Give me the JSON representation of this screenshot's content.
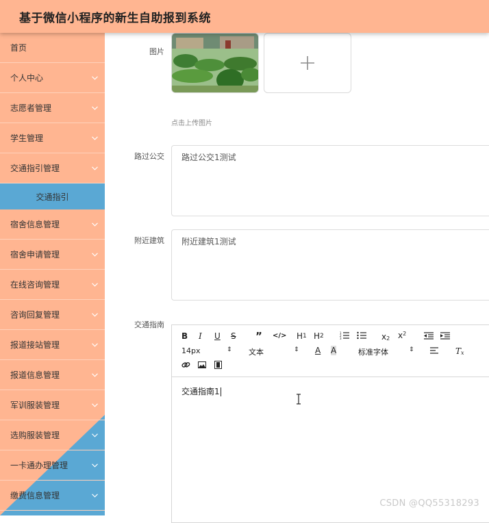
{
  "header": {
    "title": "基于微信小程序的新生自助报到系统"
  },
  "sidebar": {
    "items": [
      {
        "label": "首页",
        "chevron": false
      },
      {
        "label": "个人中心",
        "chevron": true
      },
      {
        "label": "志愿者管理",
        "chevron": true
      },
      {
        "label": "学生管理",
        "chevron": true
      },
      {
        "label": "交通指引管理",
        "chevron": true
      },
      {
        "label": "交通指引",
        "sub": true
      },
      {
        "label": "宿舍信息管理",
        "chevron": true
      },
      {
        "label": "宿舍申请管理",
        "chevron": true
      },
      {
        "label": "在线咨询管理",
        "chevron": true
      },
      {
        "label": "咨询回复管理",
        "chevron": true
      },
      {
        "label": "报道接站管理",
        "chevron": true
      },
      {
        "label": "报道信息管理",
        "chevron": true
      },
      {
        "label": "军训服装管理",
        "chevron": true
      },
      {
        "label": "选购服装管理",
        "chevron": true
      },
      {
        "label": "一卡通办理管理",
        "chevron": true
      },
      {
        "label": "缴费信息管理",
        "chevron": true
      }
    ],
    "colors": {
      "bg": "#ffb591",
      "accent": "#5aa8d4"
    }
  },
  "form": {
    "image_label": "图片",
    "upload_hint": "点击上传图片",
    "bus_label": "路过公交",
    "bus_value": "路过公交1测试",
    "building_label": "附近建筑",
    "building_value": "附近建筑1测试",
    "guide_label": "交通指南"
  },
  "editor": {
    "font_size": "14px",
    "text_style": "文本",
    "font_family": "标准字体",
    "content": "交通指南1",
    "toolbar_icons": [
      "bold-icon",
      "italic-icon",
      "underline-icon",
      "strikethrough-icon",
      "blockquote-icon",
      "code-icon",
      "heading1-icon",
      "heading2-icon",
      "ordered-list-icon",
      "bullet-list-icon",
      "subscript-icon",
      "superscript-icon",
      "outdent-icon",
      "indent-icon",
      "font-color-icon",
      "background-color-icon",
      "align-icon",
      "clear-format-icon",
      "link-icon",
      "image-icon",
      "video-icon"
    ]
  },
  "watermark": "CSDN @QQ55318293"
}
